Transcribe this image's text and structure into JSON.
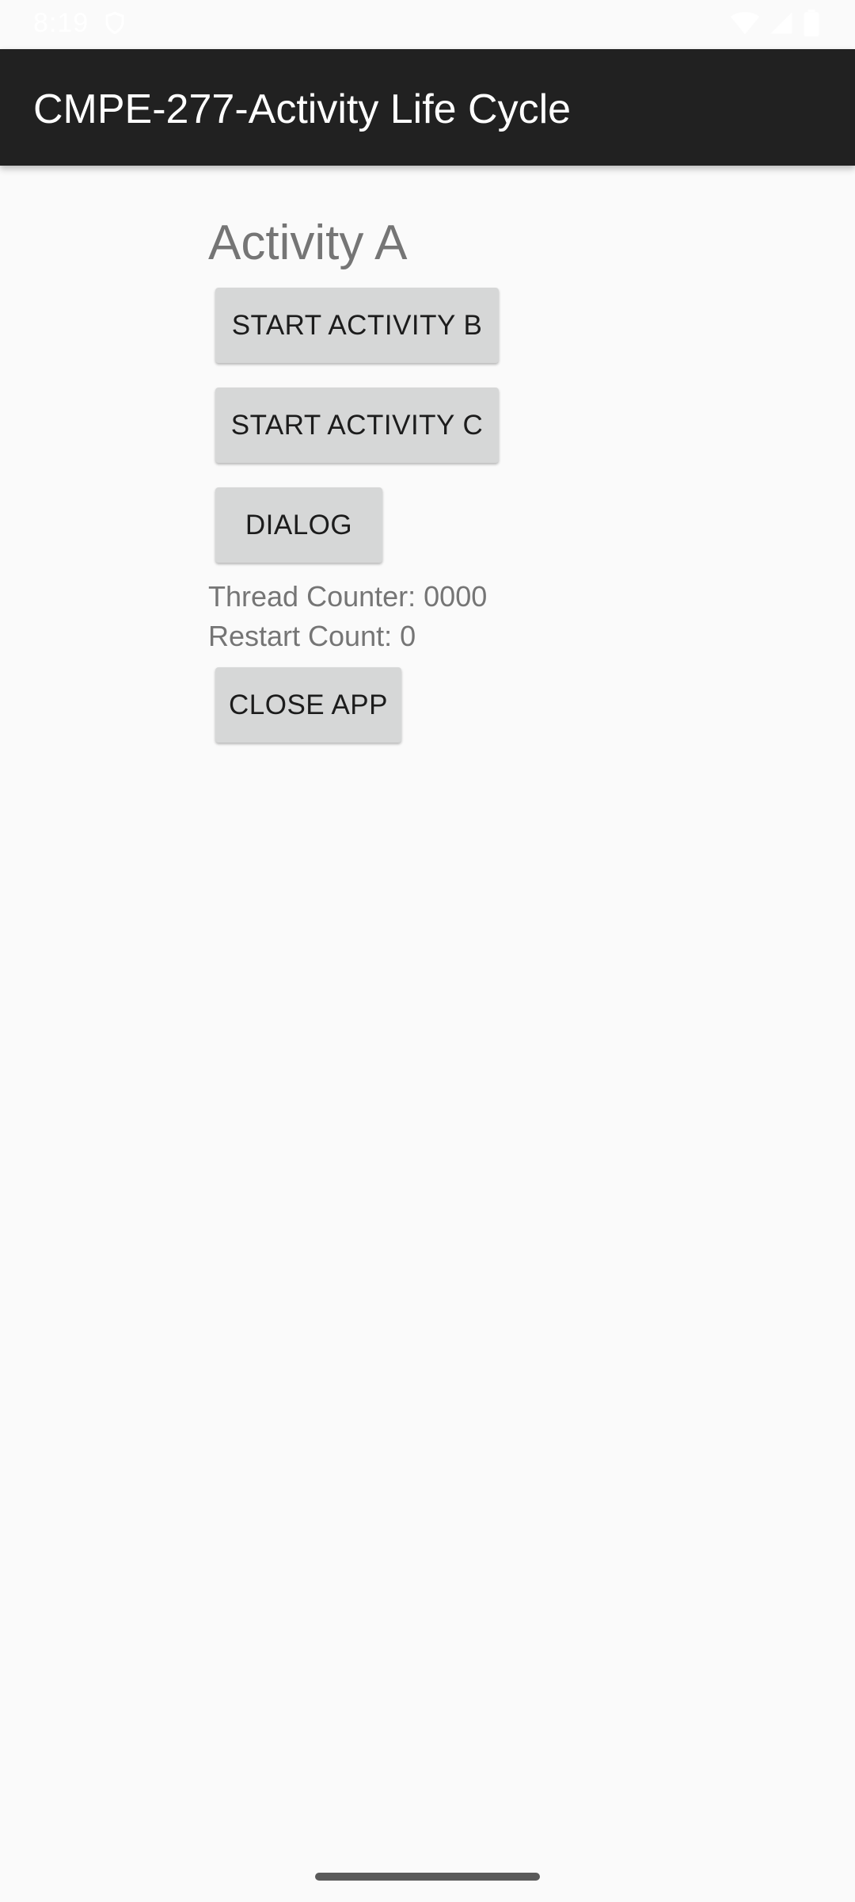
{
  "status_bar": {
    "time": "8:19",
    "icons": [
      "shield-icon",
      "wifi-icon",
      "signal-icon",
      "battery-icon"
    ]
  },
  "app_bar": {
    "title": "CMPE-277-Activity Life Cycle",
    "background": "#212121"
  },
  "main": {
    "heading": "Activity A",
    "buttons": {
      "start_b": "START ACTIVITY B",
      "start_c": "START ACTIVITY C",
      "dialog": "DIALOG",
      "close_app": "CLOSE APP"
    },
    "thread_counter": "Thread Counter: 0000",
    "restart_count": "Restart Count: 0"
  },
  "colors": {
    "background": "#fafafa",
    "button_bg": "#d6d7d7",
    "secondary_text": "#757575"
  }
}
